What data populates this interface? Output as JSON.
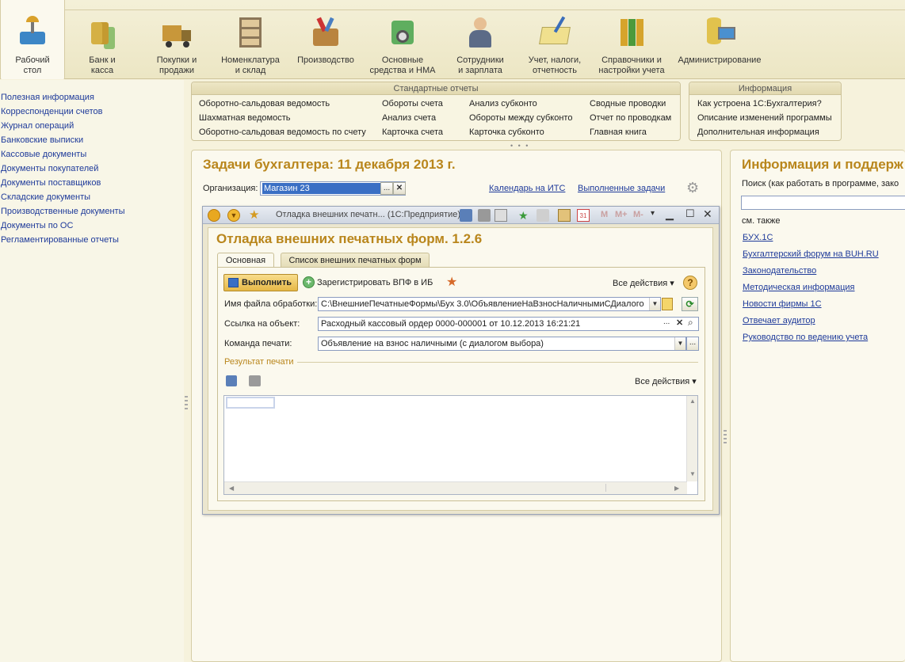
{
  "sections": [
    {
      "label": "Рабочий\nстол",
      "icon": "desk-lamp-icon",
      "active": true
    },
    {
      "label": "Банк и\nкасса",
      "icon": "coins-icon"
    },
    {
      "label": "Покупки и\nпродажи",
      "icon": "truck-icon"
    },
    {
      "label": "Номенклатура\nи склад",
      "icon": "shelf-icon"
    },
    {
      "label": "Производство",
      "icon": "toolbox-icon"
    },
    {
      "label": "Основные\nсредства и НМА",
      "icon": "assets-icon"
    },
    {
      "label": "Сотрудники\nи зарплата",
      "icon": "employee-icon"
    },
    {
      "label": "Учет, налоги,\nотчетность",
      "icon": "ledger-icon"
    },
    {
      "label": "Справочники и\nнастройки учета",
      "icon": "folders-icon"
    },
    {
      "label": "Администрирование",
      "icon": "admin-icon"
    }
  ],
  "leftnav": [
    "Полезная информация",
    "Корреспонденции счетов",
    "Журнал операций",
    "Банковские выписки",
    "Кассовые документы",
    "Документы покупателей",
    "Документы поставщиков",
    "Складские документы",
    "Производственные документы",
    "Документы по ОС",
    "Регламентированные отчеты"
  ],
  "std_reports": {
    "title": "Стандартные отчеты",
    "col1": [
      "Оборотно-сальдовая ведомость",
      "Шахматная ведомость",
      "Оборотно-сальдовая ведомость по счету"
    ],
    "col2": [
      "Обороты счета",
      "Анализ счета",
      "Карточка счета"
    ],
    "col3": [
      "Анализ субконто",
      "Обороты между субконто",
      "Карточка субконто"
    ],
    "col4": [
      "Сводные проводки",
      "Отчет по проводкам",
      "Главная книга"
    ]
  },
  "info_panel": {
    "title": "Информация",
    "links": [
      "Как устроена 1С:Бухгалтерия?",
      "Описание изменений программы",
      "Дополнительная информация"
    ]
  },
  "tasks": {
    "title": "Задачи бухгалтера: 11 декабря 2013 г.",
    "org_label": "Организация:",
    "org_value": "Магазин 23",
    "calendar_link": "Календарь на ИТС",
    "done_link": "Выполненные задачи"
  },
  "modal": {
    "window_title": "Отладка внешних печатн... (1С:Предприятие)",
    "form_title": "Отладка внешних печатных форм. 1.2.6",
    "tabs": [
      "Основная",
      "Список внешних печатных форм"
    ],
    "exec_button": "Выполнить",
    "register_button": "Зарегистрировать ВПФ в ИБ",
    "all_actions": "Все действия",
    "file_label": "Имя файла обработки:",
    "file_value": "C:\\ВнешниеПечатныеФормы\\Бух 3.0\\ОбъявлениеНаВзносНаличнымиСДиалого",
    "object_label": "Ссылка на объект:",
    "object_value": "Расходный кассовый ордер 0000-000001 от 10.12.2013 16:21:21",
    "command_label": "Команда печати:",
    "command_value": "Объявление на взнос наличными (с диалогом выбора)",
    "result_label": "Результат печати",
    "result_all_actions": "Все действия",
    "toolbar_m": "M",
    "toolbar_mplus": "M+",
    "toolbar_mminus": "M-"
  },
  "right": {
    "title": "Информация и поддерж",
    "search_label": "Поиск (как работать в программе, зако",
    "see_also": "см. также",
    "links": [
      "БУХ.1С",
      "Бухгалтерский форум на BUH.RU",
      "Законодательство",
      "Методическая информация",
      "Новости фирмы 1С",
      "Отвечает аудитор",
      "Руководство по ведению учета"
    ]
  },
  "colors": {
    "accent": "#b9861c",
    "link": "#1e3a9a",
    "background": "#f6f2dc"
  }
}
